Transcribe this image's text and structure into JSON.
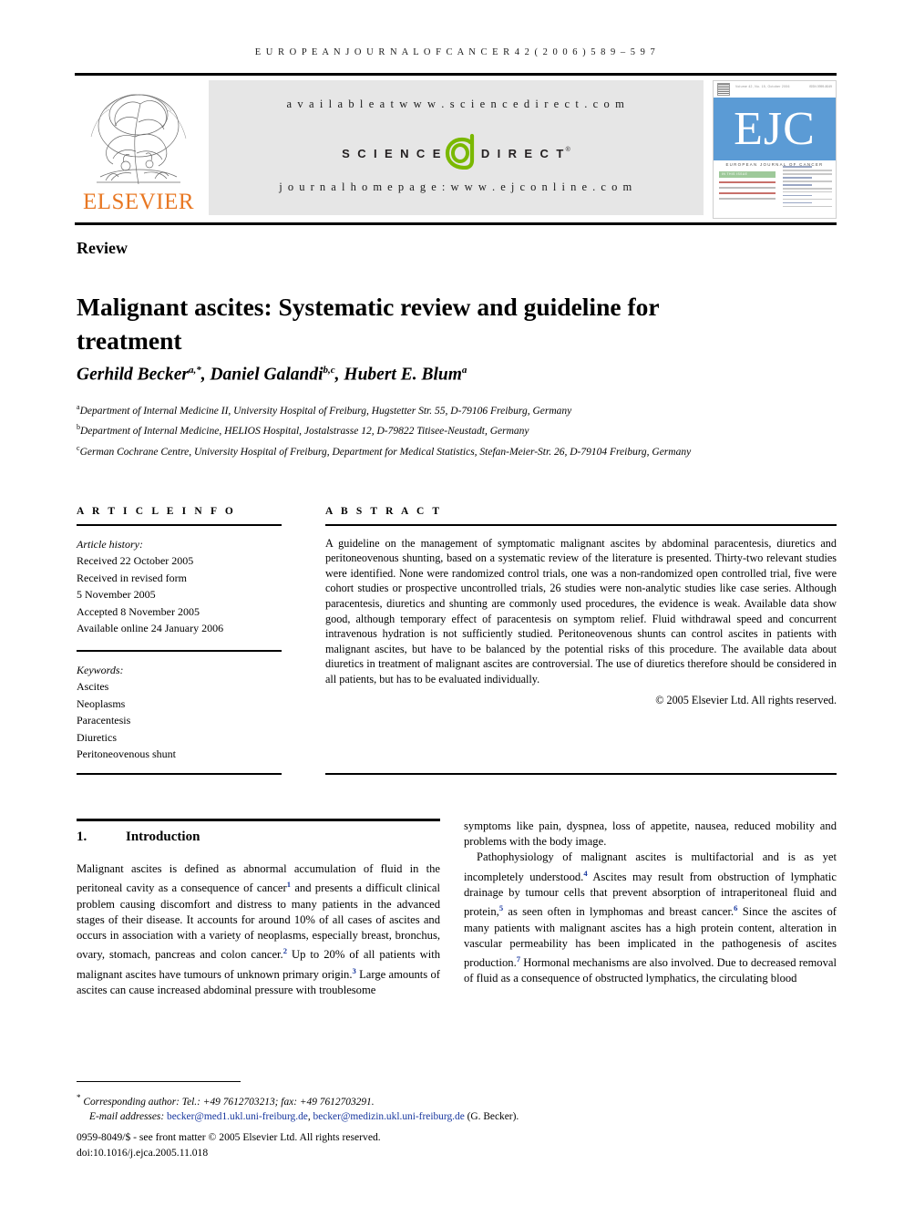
{
  "running_head": "E U R O P E A N   J O U R N A L   O F   C A N C E R   4 2   ( 2 0 0 6 )   5 8 9 – 5 9 7",
  "masthead": {
    "elsevier_wordmark": "ELSEVIER",
    "available_at": "a v a i l a b l e   a t   w w w . s c i e n c e d i r e c t . c o m",
    "sciencedirect_science": "S C I E N C E",
    "sciencedirect_direct": "D I R E C T",
    "sciencedirect_reg": "®",
    "journal_homepage": "j o u r n a l   h o m e p a g e :   w w w . e j c o n l i n e . c o m",
    "cover": {
      "letters": "EJC",
      "full_name": "EUROPEAN JOURNAL OF CANCER",
      "top_caption": "Volume 42, No. 15, October 2006",
      "issn": "ISSN 0959-8049",
      "green_bar_label": "IN THIS ISSUE"
    },
    "colors": {
      "elsevier_orange": "#e87722",
      "sciencedirect_green": "#7ab800",
      "ejc_blue": "#5b9bd5",
      "band_grey": "#e6e6e6"
    }
  },
  "article": {
    "section_label": "Review",
    "title": "Malignant ascites: Systematic review and guideline for treatment",
    "authors_html": "Gerhild Becker<sup>a,</sup><sup>*</sup>, Daniel Galandi<sup>b,c</sup>, Hubert E. Blum<sup>a</sup>",
    "affiliations": [
      "Department of Internal Medicine II, University Hospital of Freiburg, Hugstetter Str. 55, D-79106 Freiburg, Germany",
      "Department of Internal Medicine, HELIOS Hospital, Jostalstrasse 12, D-79822 Titisee-Neustadt, Germany",
      "German Cochrane Centre, University Hospital of Freiburg, Department for Medical Statistics, Stefan-Meier-Str. 26, D-79104 Freiburg, Germany"
    ],
    "affiliation_markers": [
      "a",
      "b",
      "c"
    ]
  },
  "article_info": {
    "heading": "A R T I C L E   I N F O",
    "history_label": "Article history:",
    "history": [
      "Received 22 October 2005",
      "Received in revised form",
      "5 November 2005",
      "Accepted 8 November 2005",
      "Available online 24 January 2006"
    ],
    "keywords_label": "Keywords:",
    "keywords": [
      "Ascites",
      "Neoplasms",
      "Paracentesis",
      "Diuretics",
      "Peritoneovenous shunt"
    ]
  },
  "abstract": {
    "heading": "A B S T R A C T",
    "text": "A guideline on the management of symptomatic malignant ascites by abdominal paracentesis, diuretics and peritoneovenous shunting, based on a systematic review of the literature is presented. Thirty-two relevant studies were identified. None were randomized control trials, one was a non-randomized open controlled trial, five were cohort studies or prospective uncontrolled trials, 26 studies were non-analytic studies like case series. Although paracentesis, diuretics and shunting are commonly used procedures, the evidence is weak. Available data show good, although temporary effect of paracentesis on symptom relief. Fluid withdrawal speed and concurrent intravenous hydration is not sufficiently studied. Peritoneovenous shunts can control ascites in patients with malignant ascites, but have to be balanced by the potential risks of this procedure. The available data about diuretics in treatment of malignant ascites are controversial. The use of diuretics therefore should be considered in all patients, but has to be evaluated individually.",
    "copyright": "© 2005 Elsevier Ltd. All rights reserved."
  },
  "body": {
    "section_number": "1.",
    "section_title": "Introduction",
    "left_paragraph_1_pre": "Malignant ascites is defined as abnormal accumulation of fluid in the peritoneal cavity as a consequence of cancer",
    "left_ref_1": "1",
    "left_paragraph_1_mid": " and presents a difficult clinical problem causing discomfort and distress to many patients in the advanced stages of their disease. It accounts for around 10% of all cases of ascites and occurs in association with a variety of neoplasms, especially breast, bronchus, ovary, stomach, pancreas and colon cancer.",
    "left_ref_2": "2",
    "left_paragraph_1_mid2": " Up to 20% of all patients with malignant ascites have tumours of unknown primary origin.",
    "left_ref_3": "3",
    "left_paragraph_1_end": " Large amounts of ascites can cause increased abdominal pressure with troublesome",
    "right_paragraph_1": "symptoms like pain, dyspnea, loss of appetite, nausea, reduced mobility and problems with the body image.",
    "right_paragraph_2_pre": "Pathophysiology of malignant ascites is multifactorial and is as yet incompletely understood.",
    "right_ref_4": "4",
    "right_paragraph_2_mid": " Ascites may result from obstruction of lymphatic drainage by tumour cells that prevent absorption of intraperitoneal fluid and protein,",
    "right_ref_5": "5",
    "right_paragraph_2_mid2": " as seen often in lymphomas and breast cancer.",
    "right_ref_6": "6",
    "right_paragraph_2_mid3": " Since the ascites of many patients with malignant ascites has a high protein content, alteration in vascular permeability has been implicated in the pathogenesis of ascites production.",
    "right_ref_7": "7",
    "right_paragraph_2_end": " Hormonal mechanisms are also involved. Due to decreased removal of fluid as a consequence of obstructed lymphatics, the circulating blood"
  },
  "footer": {
    "corresponding_marker": "*",
    "corresponding_text": "Corresponding author: Tel.: +49 7612703213; fax: +49 7612703291.",
    "email_label": "E-mail addresses:",
    "email_1": "becker@med1.ukl.uni-freiburg.de",
    "email_separator": ", ",
    "email_2": "becker@medizin.ukl.uni-freiburg.de",
    "email_attribution": " (G. Becker).",
    "front_matter": "0959-8049/$ - see front matter © 2005 Elsevier Ltd. All rights reserved.",
    "doi": "doi:10.1016/j.ejca.2005.11.018"
  }
}
